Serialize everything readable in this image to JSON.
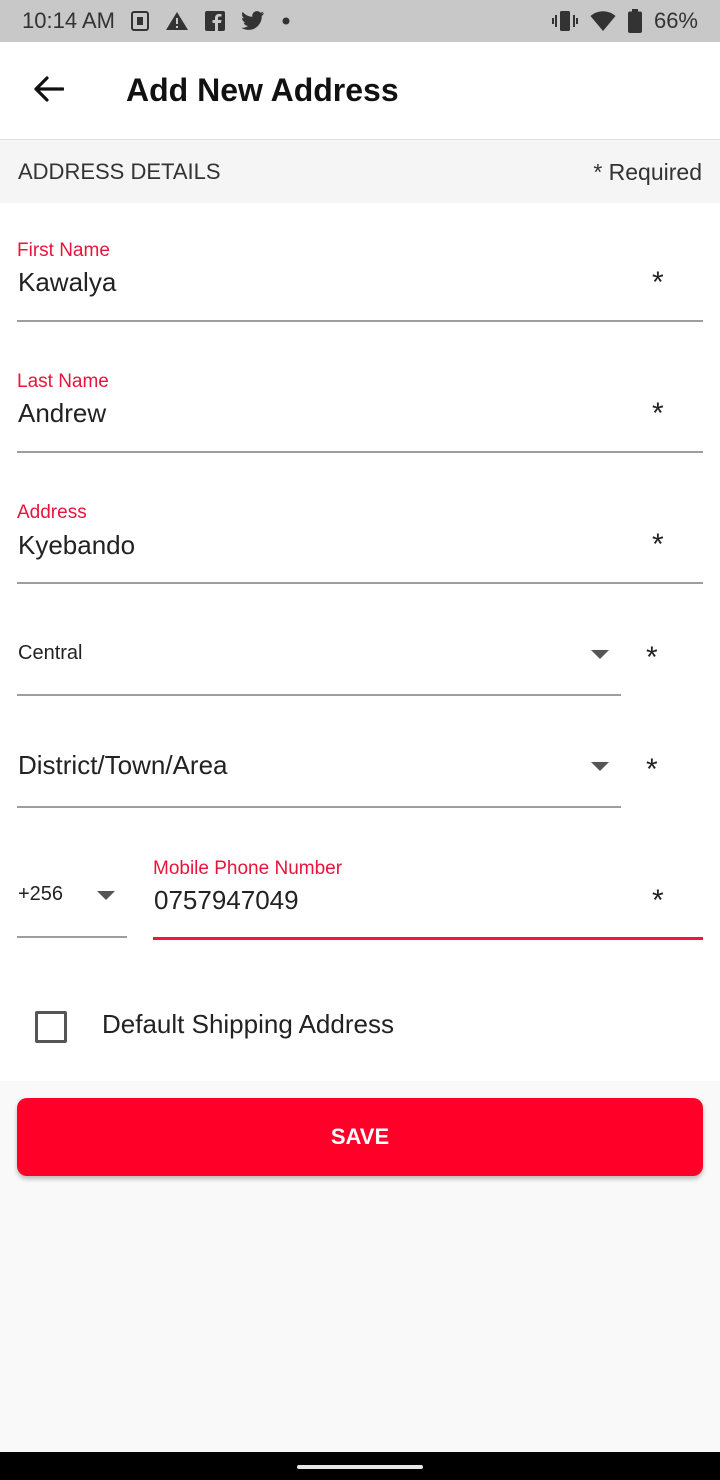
{
  "status_bar": {
    "time": "10:14 AM",
    "battery": "66%",
    "icons_left": [
      "sim-icon",
      "warning-icon",
      "facebook-icon",
      "twitter-icon",
      "dot-icon"
    ],
    "icons_right": [
      "vibrate-icon",
      "wifi-icon",
      "battery-icon"
    ]
  },
  "app_bar": {
    "title": "Add New Address",
    "back_icon": "arrow-left-icon"
  },
  "section": {
    "title": "ADDRESS DETAILS",
    "required_note": "* Required"
  },
  "form": {
    "first_name": {
      "label": "First Name",
      "value": "Kawalya",
      "required": "*"
    },
    "last_name": {
      "label": "Last Name",
      "value": "Andrew",
      "required": "*"
    },
    "address": {
      "label": "Address",
      "value": "Kyebando",
      "required": "*"
    },
    "region": {
      "value": "Central",
      "required": "*"
    },
    "district": {
      "value": "District/Town/Area",
      "required": "*"
    },
    "country_code": {
      "value": "+256"
    },
    "phone": {
      "label": "Mobile Phone Number",
      "value": "0757947049",
      "required": "*"
    },
    "default_shipping": {
      "label": "Default Shipping Address",
      "checked": false
    }
  },
  "save_button": {
    "label": "SAVE"
  },
  "colors": {
    "accent": "#e8143c",
    "button": "#ff0028",
    "status_bar": "#c8c8c8"
  }
}
